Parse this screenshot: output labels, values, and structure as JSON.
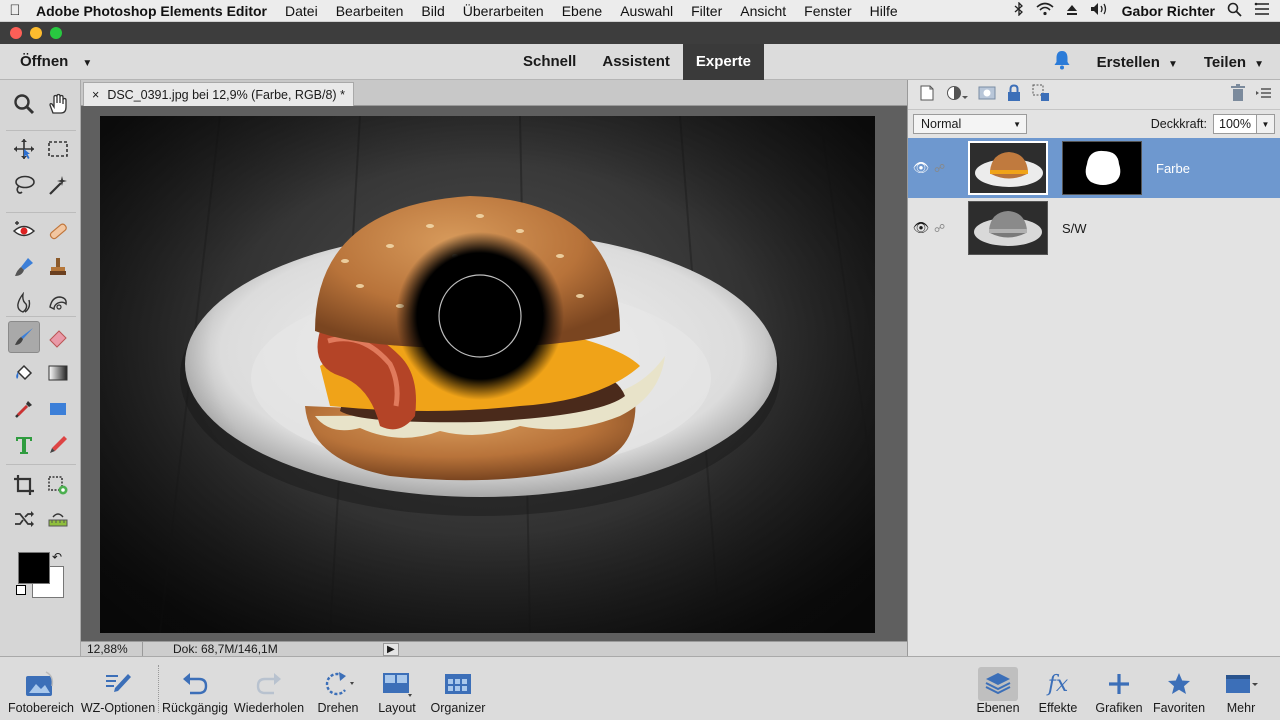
{
  "menubar": {
    "app_name": "Adobe Photoshop Elements Editor",
    "items": [
      "Datei",
      "Bearbeiten",
      "Bild",
      "Überarbeiten",
      "Ebene",
      "Auswahl",
      "Filter",
      "Ansicht",
      "Fenster",
      "Hilfe"
    ],
    "user": "Gabor Richter"
  },
  "modebar": {
    "open_label": "Öffnen",
    "modes": [
      "Schnell",
      "Assistent",
      "Experte"
    ],
    "active_mode": "Experte",
    "create_label": "Erstellen",
    "share_label": "Teilen"
  },
  "document": {
    "tab_title": "DSC_0391.jpg bei 12,9% (Farbe, RGB/8) *",
    "close_glyph": "×"
  },
  "statusbar": {
    "zoom": "12,88%",
    "doc_size": "Dok: 68,7M/146,1M"
  },
  "layers_panel": {
    "blend_mode": "Normal",
    "opacity_label": "Deckkraft:",
    "opacity_value": "100%",
    "layers": [
      {
        "name": "Farbe",
        "selected": true,
        "has_mask": true
      },
      {
        "name": "S/W",
        "selected": false,
        "has_mask": false
      }
    ]
  },
  "bottombar": {
    "fotobereich": "Fotobereich",
    "wz_optionen": "WZ-Optionen",
    "rueckgaengig": "Rückgängig",
    "wiederholen": "Wiederholen",
    "drehen": "Drehen",
    "layout": "Layout",
    "organizer": "Organizer",
    "ebenen": "Ebenen",
    "effekte": "Effekte",
    "grafiken": "Grafiken",
    "favoriten": "Favoriten",
    "mehr": "Mehr"
  },
  "colors": {
    "accent_blue": "#6e98cf",
    "notification_blue": "#2b7bd8"
  }
}
